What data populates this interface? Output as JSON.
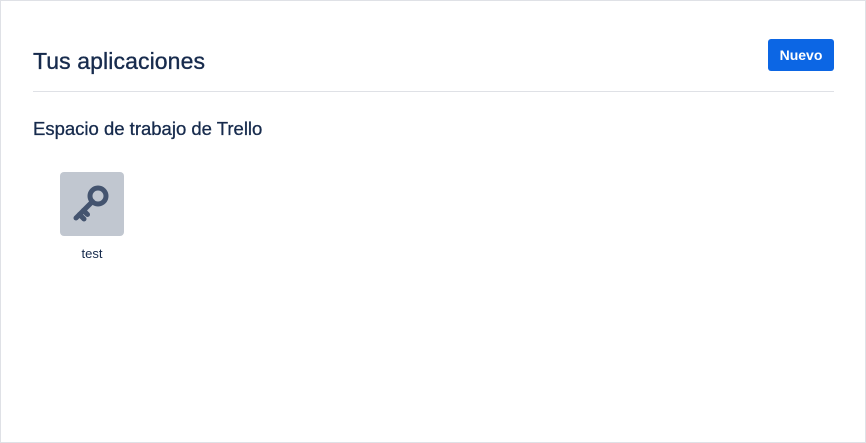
{
  "header": {
    "title": "Tus aplicaciones",
    "new_button_label": "Nuevo"
  },
  "workspace": {
    "title": "Espacio de trabajo de Trello",
    "apps": [
      {
        "name": "test",
        "icon": "key-icon"
      }
    ]
  },
  "colors": {
    "primary_button": "#0c66e4",
    "text": "#172b4d",
    "icon_background": "#c1c7d0",
    "icon_foreground": "#44546f",
    "divider": "#dfe1e6"
  }
}
